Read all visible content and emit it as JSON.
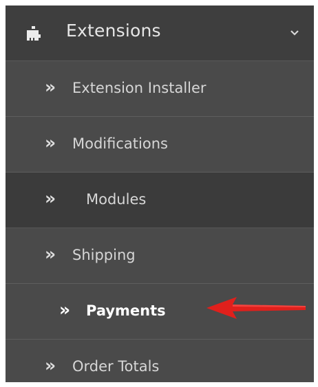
{
  "menu": {
    "header": {
      "label": "Extensions",
      "icon": "puzzle-icon",
      "chevron": "chevron-down-icon"
    },
    "items": [
      {
        "label": "Extension Installer",
        "glyph": "»",
        "state": "default"
      },
      {
        "label": "Modifications",
        "glyph": "»",
        "state": "default"
      },
      {
        "label": "Modules",
        "glyph": "»",
        "state": "active"
      },
      {
        "label": "Shipping",
        "glyph": "»",
        "state": "default"
      },
      {
        "label": "Payments",
        "glyph": "»",
        "state": "highlighted"
      },
      {
        "label": "Order Totals",
        "glyph": "»",
        "state": "default"
      }
    ]
  },
  "annotation": {
    "type": "red-arrow-pointer",
    "color": "#e0201c"
  },
  "colors": {
    "menu_bg": "#4a4a4a",
    "header_bg": "#3e3e3e",
    "active_bg": "#3b3b3b",
    "text": "#d6d6d6",
    "text_bright": "#ffffff"
  }
}
